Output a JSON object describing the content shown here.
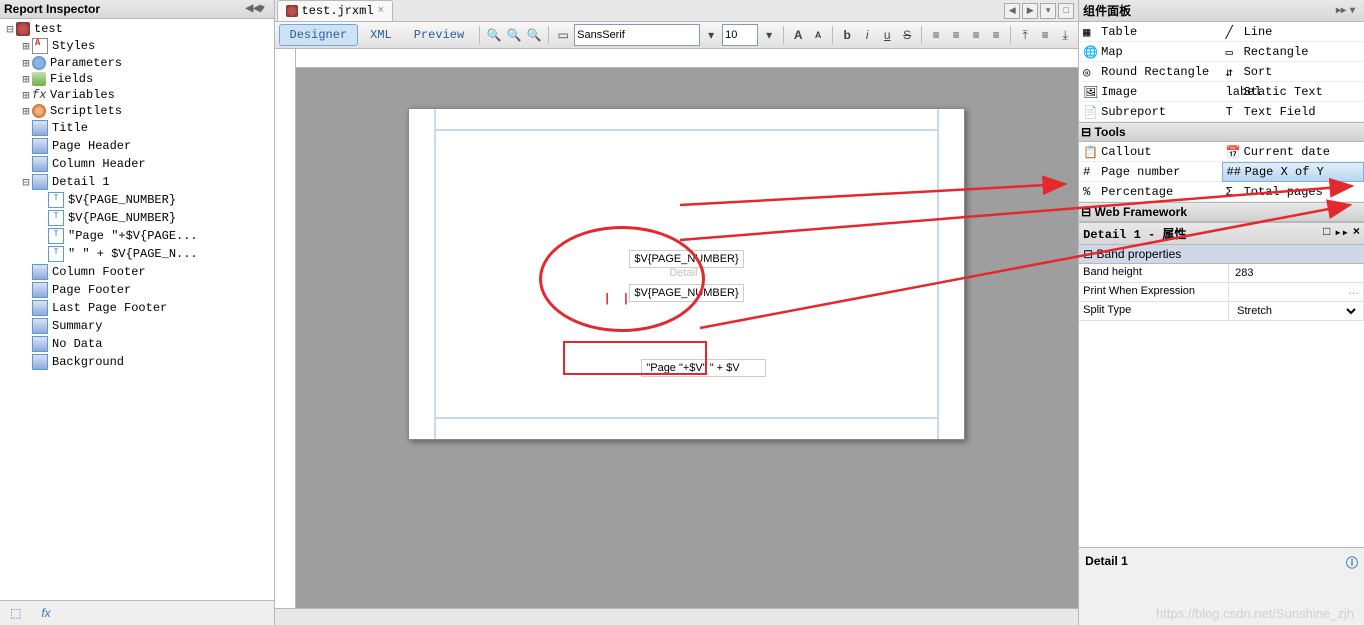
{
  "left": {
    "title": "Report Inspector",
    "root": "test",
    "items": [
      {
        "label": "Styles",
        "icon": "ic-style",
        "ind": 1,
        "tw": "⊞"
      },
      {
        "label": "Parameters",
        "icon": "ic-param",
        "ind": 1,
        "tw": "⊞"
      },
      {
        "label": "Fields",
        "icon": "ic-field",
        "ind": 1,
        "tw": "⊞"
      },
      {
        "label": "Variables",
        "icon": "ic-var",
        "ind": 1,
        "tw": "⊞",
        "txt": "fx"
      },
      {
        "label": "Scriptlets",
        "icon": "ic-scr",
        "ind": 1,
        "tw": "⊞"
      },
      {
        "label": "Title",
        "icon": "ic-band",
        "ind": 1,
        "tw": " "
      },
      {
        "label": "Page Header",
        "icon": "ic-band",
        "ind": 1,
        "tw": " "
      },
      {
        "label": "Column Header",
        "icon": "ic-band",
        "ind": 1,
        "tw": " "
      },
      {
        "label": "Detail 1",
        "icon": "ic-band",
        "ind": 1,
        "tw": "⊟"
      },
      {
        "label": "$V{PAGE_NUMBER}",
        "icon": "ic-text",
        "ind": 2,
        "tw": " ",
        "txt": "T"
      },
      {
        "label": "$V{PAGE_NUMBER}",
        "icon": "ic-text",
        "ind": 2,
        "tw": " ",
        "txt": "T"
      },
      {
        "label": "\"Page \"+$V{PAGE...",
        "icon": "ic-text",
        "ind": 2,
        "tw": " ",
        "txt": "T"
      },
      {
        "label": "\" \" + $V{PAGE_N...",
        "icon": "ic-text",
        "ind": 2,
        "tw": " ",
        "txt": "T"
      },
      {
        "label": "Column Footer",
        "icon": "ic-band",
        "ind": 1,
        "tw": " "
      },
      {
        "label": "Page Footer",
        "icon": "ic-band",
        "ind": 1,
        "tw": " "
      },
      {
        "label": "Last Page Footer",
        "icon": "ic-band",
        "ind": 1,
        "tw": " "
      },
      {
        "label": "Summary",
        "icon": "ic-band",
        "ind": 1,
        "tw": " "
      },
      {
        "label": "No Data",
        "icon": "ic-band",
        "ind": 1,
        "tw": " "
      },
      {
        "label": "Background",
        "icon": "ic-band",
        "ind": 1,
        "tw": " "
      }
    ],
    "bottom_icons": [
      "⬚",
      "fx"
    ]
  },
  "tabs": {
    "active": "test.jrxml"
  },
  "toolbar": {
    "modes": [
      "Designer",
      "XML",
      "Preview"
    ],
    "font_family": "SansSerif",
    "font_size": "10"
  },
  "designer": {
    "band_label": "Detail 1",
    "fields": [
      "$V{PAGE_NUMBER}",
      "$V{PAGE_NUMBER}",
      "\"Page \"+$V\" \" + $V"
    ]
  },
  "palette": {
    "title": "组件面板",
    "items_top": [
      {
        "l": "Table",
        "r": "Line",
        "li": "▦",
        "ri": "╱"
      },
      {
        "l": "Map",
        "r": "Rectangle",
        "li": "🌐",
        "ri": "▭"
      },
      {
        "l": "Round Rectangle",
        "r": "Sort",
        "li": "◎",
        "ri": "⇵"
      },
      {
        "l": "Image",
        "r": "Static Text",
        "li": "🖼",
        "ri": "label"
      },
      {
        "l": "Subreport",
        "r": "Text Field",
        "li": "📄",
        "ri": "T"
      }
    ],
    "cat_tools": "Tools",
    "items_tools": [
      {
        "l": "Callout",
        "r": "Current date",
        "li": "📋",
        "ri": "📅"
      },
      {
        "l": "Page number",
        "r": "Page X of Y",
        "li": "#",
        "ri": "##",
        "rhl": true
      },
      {
        "l": "Percentage",
        "r": "Total pages",
        "li": "%",
        "ri": "Σ"
      }
    ],
    "cat_web": "Web Framework"
  },
  "props": {
    "title": "Detail 1 - 属性",
    "cat": "Band properties",
    "rows": [
      {
        "k": "Band height",
        "v": "283"
      },
      {
        "k": "Print When Expression",
        "v": ""
      },
      {
        "k": "Split Type",
        "v": "Stretch"
      }
    ],
    "desc_title": "Detail 1"
  },
  "watermark": "https://blog.csdn.net/Sunshine_zjh"
}
